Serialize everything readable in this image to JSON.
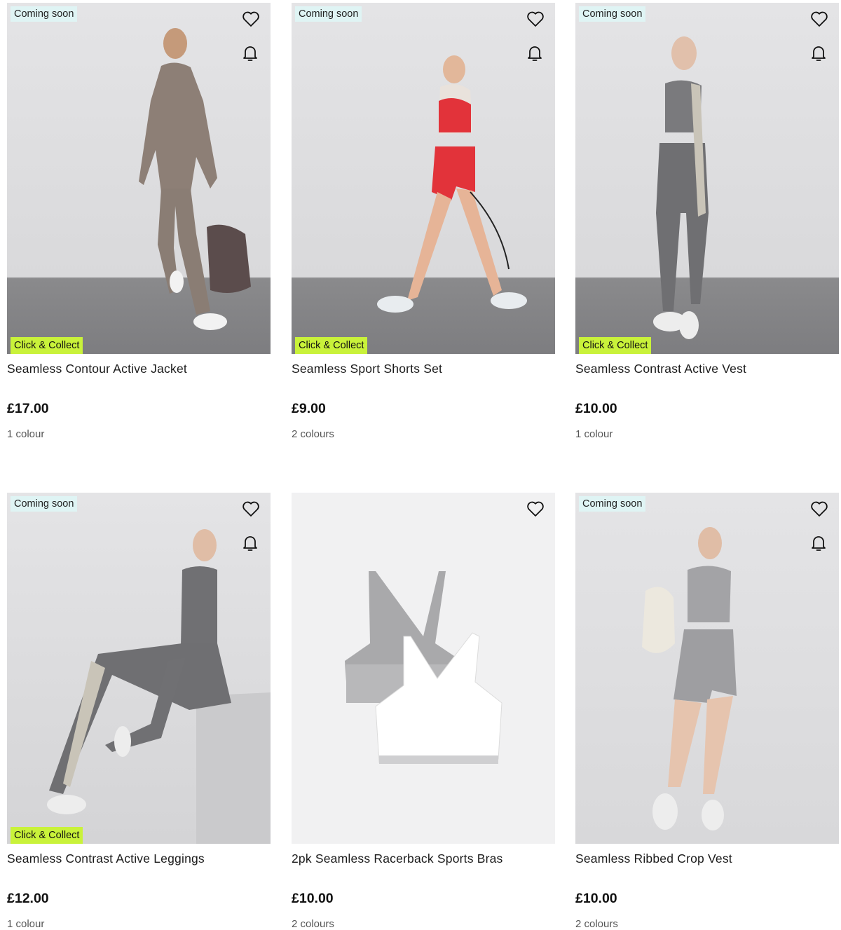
{
  "products": [
    {
      "badge_top": "Coming soon",
      "badge_bottom": "Click & Collect",
      "title": "Seamless Contour Active Jacket",
      "price": "£17.00",
      "colours": "1 colour"
    },
    {
      "badge_top": "Coming soon",
      "badge_bottom": "Click & Collect",
      "title": "Seamless Sport Shorts Set",
      "price": "£9.00",
      "colours": "2 colours"
    },
    {
      "badge_top": "Coming soon",
      "badge_bottom": "Click & Collect",
      "title": "Seamless Contrast Active Vest",
      "price": "£10.00",
      "colours": "1 colour"
    },
    {
      "badge_top": "Coming soon",
      "badge_bottom": "Click & Collect",
      "title": "Seamless Contrast Active Leggings",
      "price": "£12.00",
      "colours": "1 colour"
    },
    {
      "title": "2pk Seamless Racerback Sports Bras",
      "price": "£10.00",
      "colours": "2 colours"
    },
    {
      "badge_top": "Coming soon",
      "title": "Seamless Ribbed Crop Vest",
      "price": "£10.00",
      "colours": "2 colours"
    }
  ],
  "icons": {
    "wishlist": "heart-icon",
    "notify": "bell-icon"
  },
  "colors": {
    "coming_soon_bg": "#dff4f4",
    "click_collect_bg": "#c9f23a"
  }
}
